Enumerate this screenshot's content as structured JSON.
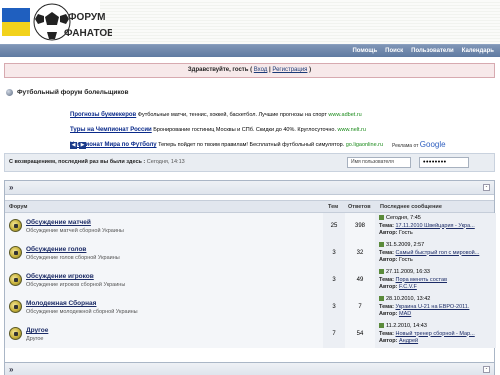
{
  "header": {
    "logo_line1": "ФОРУМ",
    "logo_line2": "ФАНАТОВ"
  },
  "nav": {
    "items": [
      "Помощь",
      "Поиск",
      "Пользователи",
      "Календарь"
    ]
  },
  "welcome": {
    "greeting": "Здравствуйте, гость",
    "open": "(",
    "login": "Вход",
    "sep": "|",
    "register": "Регистрация",
    "close": ")"
  },
  "forum_title": "Футбольный форум болельщиков",
  "ads": [
    {
      "title": "Прогнозы букмекеров",
      "text": "Футбольные матчи, теннис, хоккей, баскетбол. Лучшие прогнозы на спорт",
      "url": "www.adbet.ru"
    },
    {
      "title": "Туры на Чемпионат России",
      "text": "Бронирование гостиниц Москвы и СПб. Скидки до 40%. Круглосуточно.",
      "url": "www.nelt.ru"
    },
    {
      "title": "Чемпионат Мира по Футболу",
      "text": "Теперь пойдет по твоим правилам! Бесплатный футбольный симулятор.",
      "url": "go.ligaonline.ru"
    }
  ],
  "ad_credit": {
    "label": "Реклама от",
    "brand": "Google"
  },
  "login_strip": {
    "last_visit_label": "С возвращением, последний раз вы были здесь :",
    "last_visit_value": "Сегодня, 14:13",
    "username_value": "Имя пользователя",
    "password_value": "••••••••"
  },
  "panel": {
    "arrows": "»",
    "collapse": "-",
    "columns": {
      "forum": "Форум",
      "topics": "Тем",
      "replies": "Ответов",
      "last": "Последнее сообщение"
    }
  },
  "forums": [
    {
      "title": "Обсуждение матчей",
      "desc": "Обсуждение матчей сборной Украины",
      "topics": "25",
      "replies": "398",
      "last_date": "Сегодня, 7:45",
      "topic_label": "Тема:",
      "last_topic": "17.11.2010 Швейцария - Укра...",
      "author_label": "Автор:",
      "last_author": "Гость",
      "author_link": false
    },
    {
      "title": "Обсуждение голов",
      "desc": "Обсуждение голов сборной Украины",
      "topics": "3",
      "replies": "32",
      "last_date": "31.5.2009, 2:57",
      "topic_label": "Тема:",
      "last_topic": "Самый быстрый гол с мировой...",
      "author_label": "Автор:",
      "last_author": "Гость",
      "author_link": false
    },
    {
      "title": "Обсуждение игроков",
      "desc": "Обсуждение игроков сборной Украины",
      "topics": "3",
      "replies": "49",
      "last_date": "27.11.2009, 16:33",
      "topic_label": "Тема:",
      "last_topic": "Пора менять состав",
      "author_label": "Автор:",
      "last_author": "F.C.V.F",
      "author_link": true
    },
    {
      "title": "Молодежная Сборная",
      "desc": "Обсуждение молодежной сборной Украины",
      "topics": "3",
      "replies": "7",
      "last_date": "28.10.2010, 13:42",
      "topic_label": "Тема:",
      "last_topic": "Украина U-21 на ЕВРО-2011.",
      "author_label": "Автор:",
      "last_author": "MAD",
      "author_link": true
    },
    {
      "title": "Другое",
      "desc": "Другое",
      "topics": "7",
      "replies": "54",
      "last_date": "11.2.2010, 14:43",
      "topic_label": "Тема:",
      "last_topic": "Новый тренер сборной - Мар...",
      "author_label": "Автор:",
      "last_author": "Андрей",
      "author_link": true
    }
  ],
  "panel2": {
    "arrows": "»",
    "collapse": "-"
  },
  "colors": {
    "nav": "#6b84a9",
    "accent": "#1b2b66",
    "welcome_bg": "#f7e9ea"
  }
}
